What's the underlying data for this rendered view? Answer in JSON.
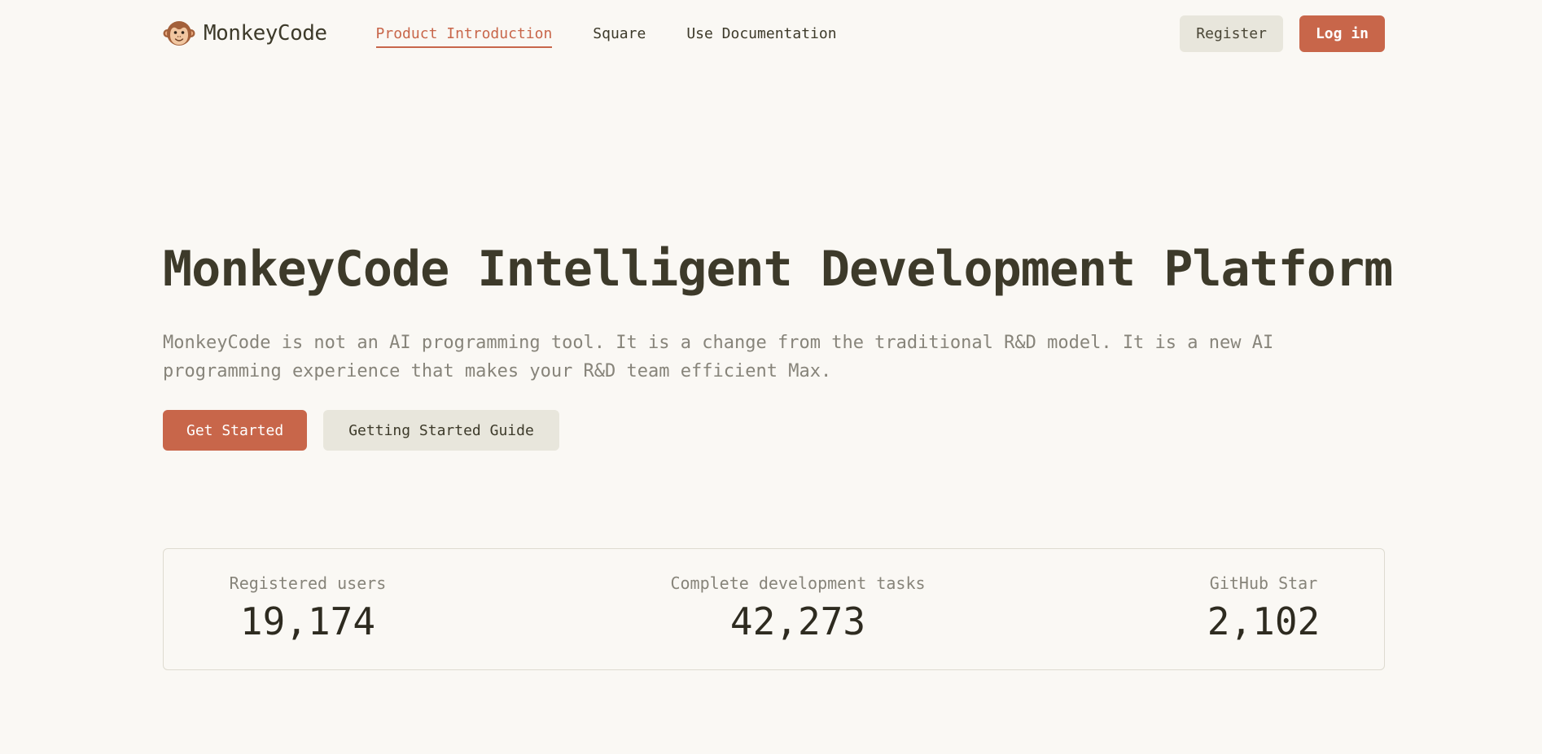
{
  "header": {
    "logo_text": "MonkeyCode",
    "logo_icon": "monkey-icon",
    "nav": [
      {
        "label": "Product Introduction",
        "active": true
      },
      {
        "label": "Square",
        "active": false
      },
      {
        "label": "Use Documentation",
        "active": false
      }
    ],
    "register_label": "Register",
    "login_label": "Log in"
  },
  "hero": {
    "title": "MonkeyCode Intelligent Development Platform",
    "description": "MonkeyCode is not an AI programming tool. It is a change from the traditional R&D model. It is a new AI programming experience that makes your R&D team efficient Max.",
    "primary_button": "Get Started",
    "secondary_button": "Getting Started Guide"
  },
  "stats": [
    {
      "label": "Registered users",
      "value": "19,174"
    },
    {
      "label": "Complete development tasks",
      "value": "42,273"
    },
    {
      "label": "GitHub Star",
      "value": "2,102"
    }
  ],
  "colors": {
    "background": "#faf8f4",
    "accent": "#c8664a",
    "text": "#3d3a2a",
    "muted": "#87847a",
    "secondary_button": "#e8e6dc"
  }
}
